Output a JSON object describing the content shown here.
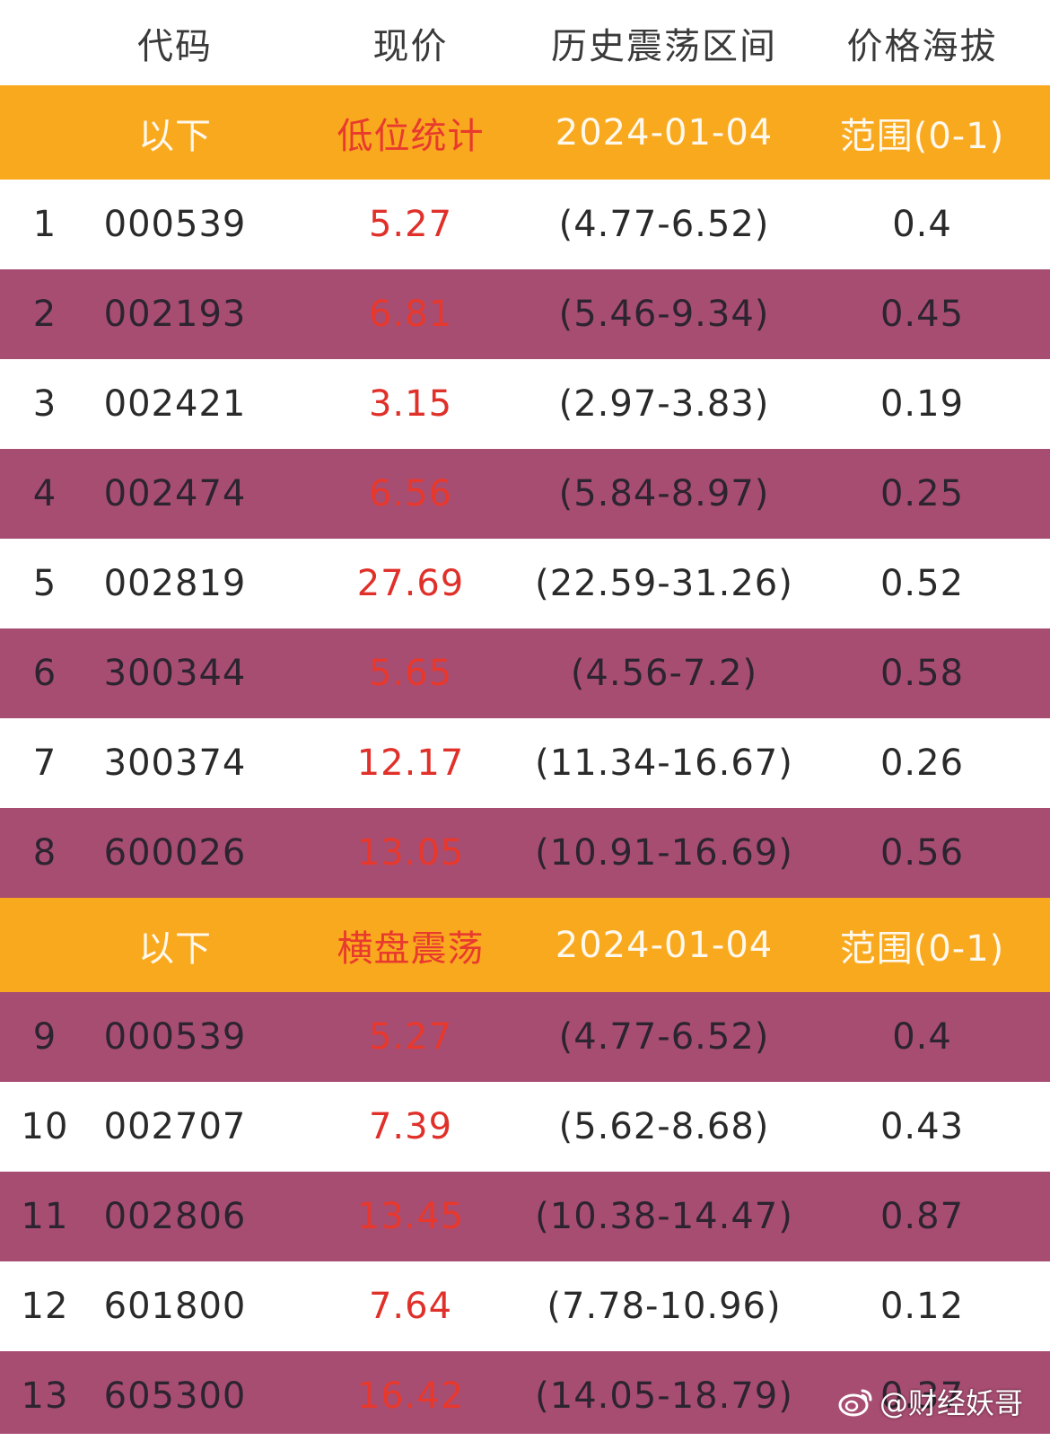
{
  "header": {
    "code": "代码",
    "price": "现价",
    "range": "历史震荡区间",
    "altitude": "价格海拔"
  },
  "sections": [
    {
      "label_left": "以下",
      "title": "低位统计",
      "date": "2024-01-04",
      "range_label": "范围(0-1)"
    },
    {
      "label_left": "以下",
      "title": "横盘震荡",
      "date": "2024-01-04",
      "range_label": "范围(0-1)"
    }
  ],
  "rows": [
    {
      "idx": "1",
      "code": "000539",
      "price": "5.27",
      "range": "(4.77-6.52)",
      "altitude": "0.4"
    },
    {
      "idx": "2",
      "code": "002193",
      "price": "6.81",
      "range": "(5.46-9.34)",
      "altitude": "0.45"
    },
    {
      "idx": "3",
      "code": "002421",
      "price": "3.15",
      "range": "(2.97-3.83)",
      "altitude": "0.19"
    },
    {
      "idx": "4",
      "code": "002474",
      "price": "6.56",
      "range": "(5.84-8.97)",
      "altitude": "0.25"
    },
    {
      "idx": "5",
      "code": "002819",
      "price": "27.69",
      "range": "(22.59-31.26)",
      "altitude": "0.52"
    },
    {
      "idx": "6",
      "code": "300344",
      "price": "5.65",
      "range": "(4.56-7.2)",
      "altitude": "0.58"
    },
    {
      "idx": "7",
      "code": "300374",
      "price": "12.17",
      "range": "(11.34-16.67)",
      "altitude": "0.26"
    },
    {
      "idx": "8",
      "code": "600026",
      "price": "13.05",
      "range": "(10.91-16.69)",
      "altitude": "0.56"
    },
    {
      "idx": "9",
      "code": "000539",
      "price": "5.27",
      "range": "(4.77-6.52)",
      "altitude": "0.4"
    },
    {
      "idx": "10",
      "code": "002707",
      "price": "7.39",
      "range": "(5.62-8.68)",
      "altitude": "0.43"
    },
    {
      "idx": "11",
      "code": "002806",
      "price": "13.45",
      "range": "(10.38-14.47)",
      "altitude": "0.87"
    },
    {
      "idx": "12",
      "code": "601800",
      "price": "7.64",
      "range": "(7.78-10.96)",
      "altitude": "0.12"
    },
    {
      "idx": "13",
      "code": "605300",
      "price": "16.42",
      "range": "(14.05-18.79)",
      "altitude": "0.37"
    }
  ],
  "watermark": {
    "text": "@财经妖哥",
    "icon": "weibo-icon"
  },
  "colors": {
    "section_bg": "#f9a91e",
    "alt_row_bg": "#a84d72",
    "price_red": "#e0302a"
  }
}
